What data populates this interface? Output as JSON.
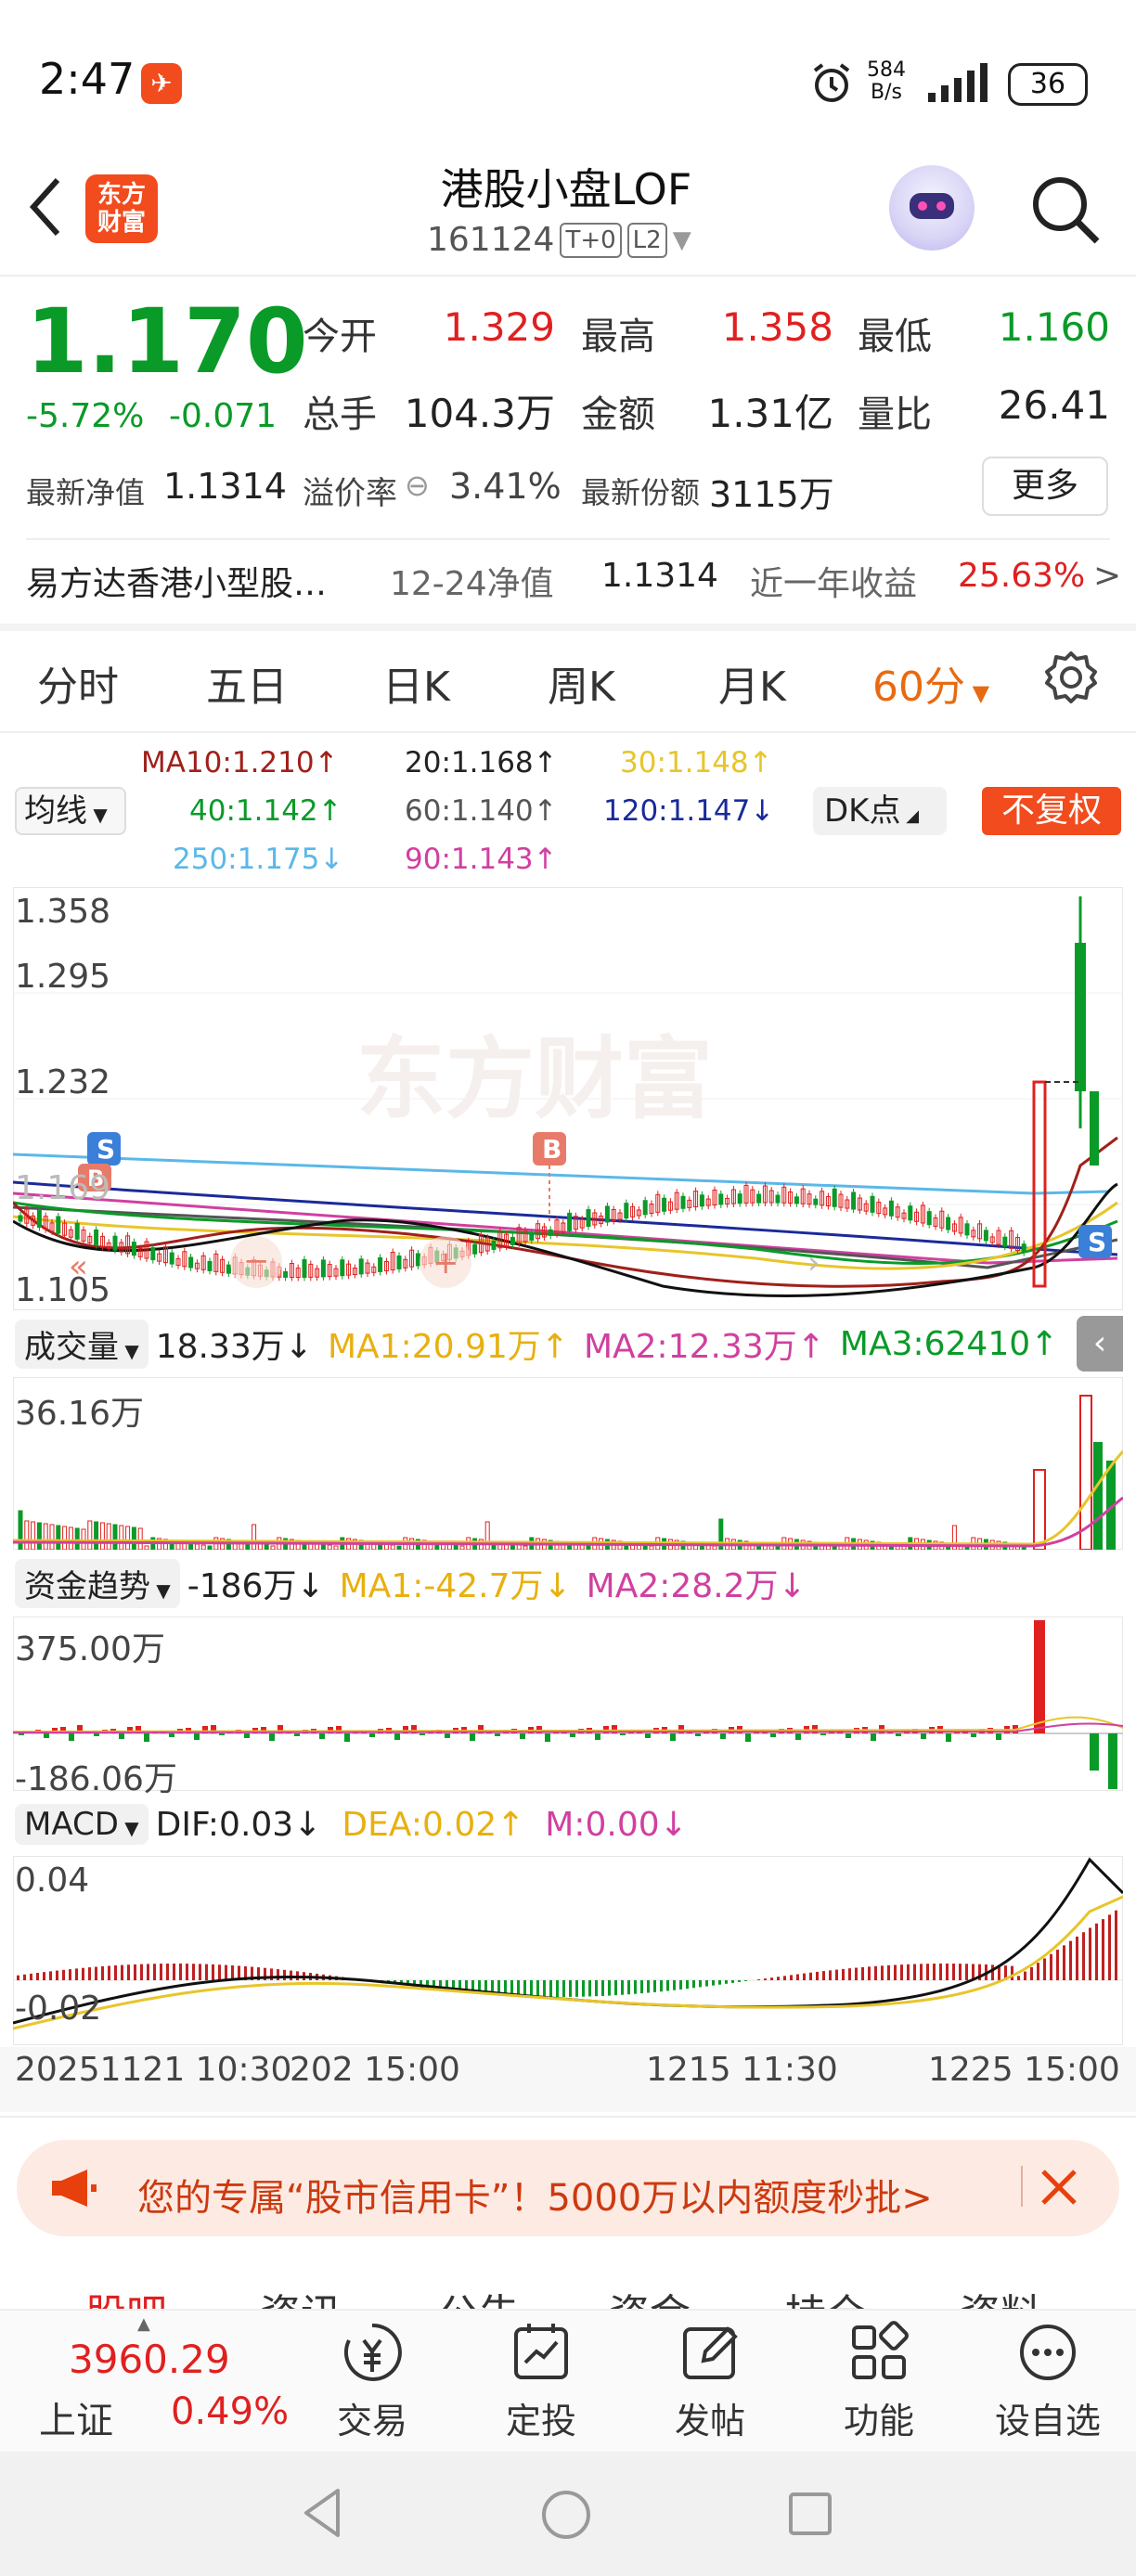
{
  "status": {
    "time": "2:47",
    "net_speed_top": "584",
    "net_speed_unit": "B/s",
    "battery": "36"
  },
  "header": {
    "logo_text_1": "东方",
    "logo_text_2": "财富",
    "title": "港股小盘LOF",
    "code": "161124",
    "tag1": "T+0",
    "tag2": "L2"
  },
  "quote": {
    "price": "1.170",
    "pct": "-5.72%",
    "chg": "-0.071",
    "open_label": "今开",
    "open": "1.329",
    "high_label": "最高",
    "high": "1.358",
    "low_label": "最低",
    "low": "1.160",
    "vol_label": "总手",
    "vol": "104.3万",
    "amt_label": "金额",
    "amt": "1.31亿",
    "ratio_label": "量比",
    "ratio": "26.41",
    "nav_label": "最新净值",
    "nav": "1.1314",
    "premium_label": "溢价率",
    "premium": "3.41%",
    "share_label": "最新份额",
    "share": "3115万",
    "more": "更多"
  },
  "fund": {
    "name": "易方达香港小型股…",
    "nav_date_label": "12-24净值",
    "nav": "1.1314",
    "year_label": "近一年收益",
    "year_return": "25.63%"
  },
  "tabs": [
    "分时",
    "五日",
    "日K",
    "周K",
    "月K",
    "60分"
  ],
  "legend": {
    "junxian": "均线",
    "ma10": "MA10:1.210↑",
    "ma20": "20:1.168↑",
    "ma30": "30:1.148↑",
    "ma40": "40:1.142↑",
    "ma60": "60:1.140↑",
    "ma120": "120:1.147↓",
    "ma250": "250:1.175↓",
    "ma90": "90:1.143↑",
    "dk": "DK点",
    "fufq": "不复权"
  },
  "kchart_axis": {
    "top": "1.358",
    "l2": "1.295",
    "l3": "1.232",
    "mid": "1.169",
    "bottom": "1.105",
    "watermark": "东方财富"
  },
  "volume": {
    "name": "成交量",
    "value": "18.33万↓",
    "ma1": "MA1:20.91万↑",
    "ma2": "MA2:12.33万↑",
    "ma3": "MA3:62410↑",
    "axis_top": "36.16万"
  },
  "capital": {
    "name": "资金趋势",
    "value": "-186万↓",
    "ma1": "MA1:-42.7万↓",
    "ma2": "MA2:28.2万↓",
    "axis_top": "375.00万",
    "axis_bottom": "-186.06万"
  },
  "macd": {
    "name": "MACD",
    "dif": "DIF:0.03↓",
    "dea": "DEA:0.02↑",
    "m": "M:0.00↓",
    "axis_top": "0.04",
    "axis_bottom": "-0.02"
  },
  "time_axis": [
    "20251121 10:30",
    "202 15:00",
    "1215 11:30",
    "1225 15:00"
  ],
  "banner": {
    "text": "您的专属“股市信用卡”！5000万以内额度秒批>"
  },
  "peek_tabs": [
    "股吧",
    "资讯",
    "公告",
    "资金",
    "持仓",
    "资料"
  ],
  "bottom": {
    "index_value": "3960.29",
    "index_name": "上证",
    "index_pct": "0.49%",
    "nav": [
      "交易",
      "定投",
      "发帖",
      "功能",
      "设自选"
    ]
  },
  "colors": {
    "accent": "#f24b1d",
    "up": "#e02020",
    "down": "#0a9a28"
  }
}
